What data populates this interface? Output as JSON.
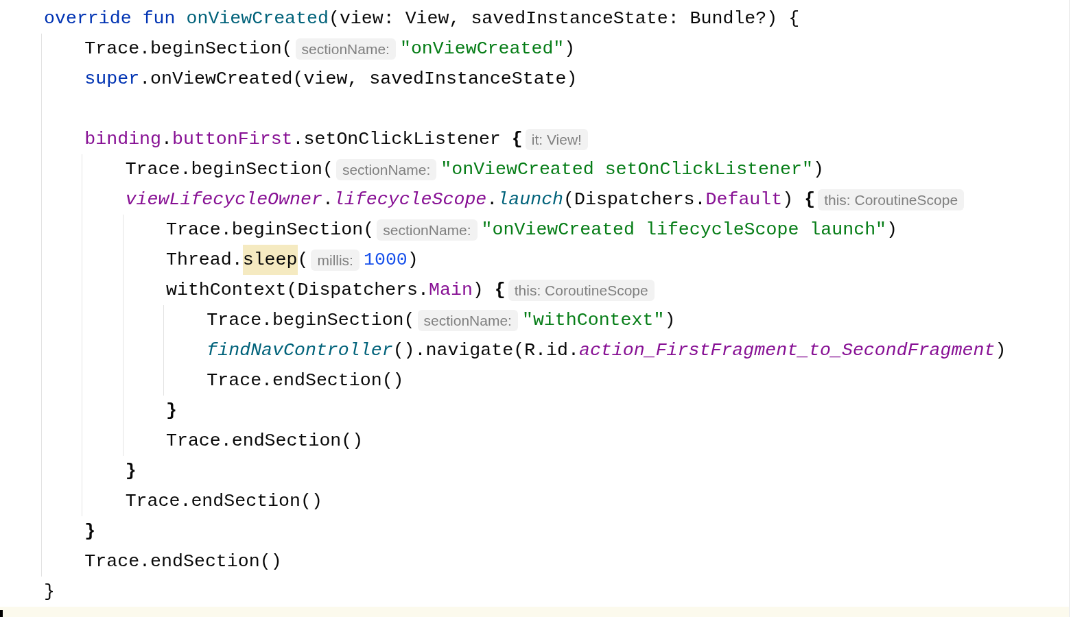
{
  "editor": {
    "lines": [
      {
        "kind": "code",
        "tokens": [
          {
            "kind": "keyword",
            "text": "override fun "
          },
          {
            "kind": "declaration",
            "text": "onViewCreated"
          },
          {
            "kind": "plain",
            "text": "(view: View, savedInstanceState: Bundle?) {"
          }
        ],
        "children": [
          {
            "kind": "code",
            "tokens": [
              {
                "kind": "plain",
                "text": "Trace.beginSection("
              },
              {
                "kind": "hint",
                "text": "sectionName:"
              },
              {
                "kind": "string",
                "text": "\"onViewCreated\""
              },
              {
                "kind": "plain",
                "text": ")"
              }
            ]
          },
          {
            "kind": "code",
            "tokens": [
              {
                "kind": "keyword",
                "text": "super"
              },
              {
                "kind": "plain",
                "text": ".onViewCreated(view, savedInstanceState)"
              }
            ]
          },
          {
            "kind": "blank"
          },
          {
            "kind": "code",
            "tokens": [
              {
                "kind": "property",
                "text": "binding"
              },
              {
                "kind": "plain",
                "text": "."
              },
              {
                "kind": "property",
                "text": "buttonFirst"
              },
              {
                "kind": "plain",
                "text": ".setOnClickListener "
              },
              {
                "kind": "brace",
                "text": "{"
              },
              {
                "kind": "hint",
                "text": "it: View!"
              }
            ],
            "children": [
              {
                "kind": "code",
                "tokens": [
                  {
                    "kind": "plain",
                    "text": "Trace.beginSection("
                  },
                  {
                    "kind": "hint",
                    "text": "sectionName:"
                  },
                  {
                    "kind": "string",
                    "text": "\"onViewCreated setOnClickListener\""
                  },
                  {
                    "kind": "plain",
                    "text": ")"
                  }
                ]
              },
              {
                "kind": "code",
                "tokens": [
                  {
                    "kind": "property-italic",
                    "text": "viewLifecycleOwner"
                  },
                  {
                    "kind": "plain",
                    "text": "."
                  },
                  {
                    "kind": "property-italic",
                    "text": "lifecycleScope"
                  },
                  {
                    "kind": "plain",
                    "text": "."
                  },
                  {
                    "kind": "call-italic",
                    "text": "launch"
                  },
                  {
                    "kind": "plain",
                    "text": "(Dispatchers."
                  },
                  {
                    "kind": "property",
                    "text": "Default"
                  },
                  {
                    "kind": "plain",
                    "text": ") "
                  },
                  {
                    "kind": "brace",
                    "text": "{"
                  },
                  {
                    "kind": "hint",
                    "text": "this: CoroutineScope"
                  }
                ],
                "children": [
                  {
                    "kind": "code",
                    "tokens": [
                      {
                        "kind": "plain",
                        "text": "Trace.beginSection("
                      },
                      {
                        "kind": "hint",
                        "text": "sectionName:"
                      },
                      {
                        "kind": "string",
                        "text": "\"onViewCreated lifecycleScope launch\""
                      },
                      {
                        "kind": "plain",
                        "text": ")"
                      }
                    ]
                  },
                  {
                    "kind": "code",
                    "tokens": [
                      {
                        "kind": "plain",
                        "text": "Thread."
                      },
                      {
                        "kind": "match",
                        "text": "sleep"
                      },
                      {
                        "kind": "plain",
                        "text": "("
                      },
                      {
                        "kind": "hint",
                        "text": "millis:"
                      },
                      {
                        "kind": "number",
                        "text": "1000"
                      },
                      {
                        "kind": "plain",
                        "text": ")"
                      }
                    ]
                  },
                  {
                    "kind": "code",
                    "tokens": [
                      {
                        "kind": "plain",
                        "text": "withContext(Dispatchers."
                      },
                      {
                        "kind": "property",
                        "text": "Main"
                      },
                      {
                        "kind": "plain",
                        "text": ") "
                      },
                      {
                        "kind": "brace",
                        "text": "{"
                      },
                      {
                        "kind": "hint",
                        "text": "this: CoroutineScope"
                      }
                    ],
                    "children": [
                      {
                        "kind": "code",
                        "tokens": [
                          {
                            "kind": "plain",
                            "text": "Trace.beginSection("
                          },
                          {
                            "kind": "hint",
                            "text": "sectionName:"
                          },
                          {
                            "kind": "string",
                            "text": "\"withContext\""
                          },
                          {
                            "kind": "plain",
                            "text": ")"
                          }
                        ]
                      },
                      {
                        "kind": "code",
                        "tokens": [
                          {
                            "kind": "call-italic",
                            "text": "findNavController"
                          },
                          {
                            "kind": "plain",
                            "text": "().navigate(R.id."
                          },
                          {
                            "kind": "property-italic",
                            "text": "action_FirstFragment_to_SecondFragment"
                          },
                          {
                            "kind": "plain",
                            "text": ")"
                          }
                        ]
                      },
                      {
                        "kind": "code",
                        "tokens": [
                          {
                            "kind": "plain",
                            "text": "Trace.endSection()"
                          }
                        ]
                      }
                    ]
                  },
                  {
                    "kind": "code",
                    "tokens": [
                      {
                        "kind": "brace",
                        "text": "}"
                      }
                    ]
                  },
                  {
                    "kind": "code",
                    "tokens": [
                      {
                        "kind": "plain",
                        "text": "Trace.endSection()"
                      }
                    ]
                  }
                ]
              },
              {
                "kind": "code",
                "tokens": [
                  {
                    "kind": "brace",
                    "text": "}"
                  }
                ]
              },
              {
                "kind": "code",
                "tokens": [
                  {
                    "kind": "plain",
                    "text": "Trace.endSection()"
                  }
                ]
              }
            ]
          },
          {
            "kind": "code",
            "tokens": [
              {
                "kind": "brace",
                "text": "}"
              }
            ]
          },
          {
            "kind": "code",
            "tokens": [
              {
                "kind": "plain",
                "text": "Trace.endSection()"
              }
            ]
          }
        ]
      },
      {
        "kind": "code",
        "tokens": [
          {
            "kind": "plain",
            "text": "}"
          }
        ]
      },
      {
        "kind": "blank",
        "current": true
      }
    ]
  }
}
